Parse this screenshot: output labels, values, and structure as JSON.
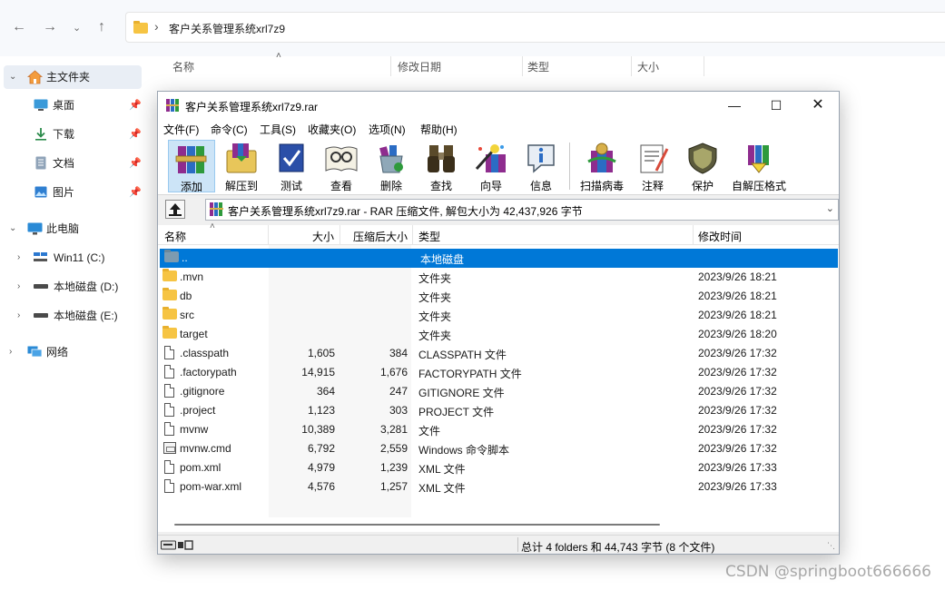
{
  "explorer": {
    "address_path": "客户关系管理系统xrl7z9",
    "columns": [
      "名称",
      "修改日期",
      "类型",
      "大小"
    ],
    "sidebar": {
      "home": "主文件夹",
      "quick": [
        "桌面",
        "下载",
        "文档",
        "图片"
      ],
      "this_pc": "此电脑",
      "drives": [
        "Win11 (C:)",
        "本地磁盘 (D:)",
        "本地磁盘 (E:)"
      ],
      "network": "网络"
    }
  },
  "rar": {
    "title": "客户关系管理系统xrl7z9.rar",
    "menu": [
      "文件(F)",
      "命令(C)",
      "工具(S)",
      "收藏夹(O)",
      "选项(N)",
      "帮助(H)"
    ],
    "toolbar": [
      {
        "label": "添加",
        "icon": "books-icon"
      },
      {
        "label": "解压到",
        "icon": "extract-folder-icon"
      },
      {
        "label": "测试",
        "icon": "test-icon"
      },
      {
        "label": "查看",
        "icon": "view-book-icon"
      },
      {
        "label": "删除",
        "icon": "delete-bin-icon"
      },
      {
        "label": "查找",
        "icon": "binoculars-icon"
      },
      {
        "label": "向导",
        "icon": "wizard-icon"
      },
      {
        "label": "信息",
        "icon": "info-icon"
      },
      {
        "label": "扫描病毒",
        "icon": "virus-scan-icon"
      },
      {
        "label": "注释",
        "icon": "comment-icon"
      },
      {
        "label": "保护",
        "icon": "shield-icon"
      },
      {
        "label": "自解压格式",
        "icon": "sfx-icon"
      }
    ],
    "path_text": "客户关系管理系统xrl7z9.rar - RAR 压缩文件, 解包大小为 42,437,926 字节",
    "columns": {
      "name": "名称",
      "size": "大小",
      "packed": "压缩后大小",
      "type": "类型",
      "modified": "修改时间"
    },
    "files": [
      {
        "name": "..",
        "size": "",
        "packed": "",
        "type": "本地磁盘",
        "modified": "",
        "kind": "up",
        "selected": true
      },
      {
        "name": ".mvn",
        "size": "",
        "packed": "",
        "type": "文件夹",
        "modified": "2023/9/26 18:21",
        "kind": "folder"
      },
      {
        "name": "db",
        "size": "",
        "packed": "",
        "type": "文件夹",
        "modified": "2023/9/26 18:21",
        "kind": "folder"
      },
      {
        "name": "src",
        "size": "",
        "packed": "",
        "type": "文件夹",
        "modified": "2023/9/26 18:21",
        "kind": "folder"
      },
      {
        "name": "target",
        "size": "",
        "packed": "",
        "type": "文件夹",
        "modified": "2023/9/26 18:20",
        "kind": "folder"
      },
      {
        "name": ".classpath",
        "size": "1,605",
        "packed": "384",
        "type": "CLASSPATH 文件",
        "modified": "2023/9/26 17:32",
        "kind": "file"
      },
      {
        "name": ".factorypath",
        "size": "14,915",
        "packed": "1,676",
        "type": "FACTORYPATH 文件",
        "modified": "2023/9/26 17:32",
        "kind": "file"
      },
      {
        "name": ".gitignore",
        "size": "364",
        "packed": "247",
        "type": "GITIGNORE 文件",
        "modified": "2023/9/26 17:32",
        "kind": "file"
      },
      {
        "name": ".project",
        "size": "1,123",
        "packed": "303",
        "type": "PROJECT 文件",
        "modified": "2023/9/26 17:32",
        "kind": "file"
      },
      {
        "name": "mvnw",
        "size": "10,389",
        "packed": "3,281",
        "type": "文件",
        "modified": "2023/9/26 17:32",
        "kind": "file"
      },
      {
        "name": "mvnw.cmd",
        "size": "6,792",
        "packed": "2,559",
        "type": "Windows 命令脚本",
        "modified": "2023/9/26 17:32",
        "kind": "cmd"
      },
      {
        "name": "pom.xml",
        "size": "4,979",
        "packed": "1,239",
        "type": "XML 文件",
        "modified": "2023/9/26 17:33",
        "kind": "file"
      },
      {
        "name": "pom-war.xml",
        "size": "4,576",
        "packed": "1,257",
        "type": "XML 文件",
        "modified": "2023/9/26 17:33",
        "kind": "file"
      }
    ],
    "status": "总计 4 folders 和 44,743 字节 (8 个文件)"
  },
  "watermark": "CSDN @springboot666666",
  "colors": {
    "selection": "#0078d7",
    "toolbar_active": "#cce4f7",
    "folder": "#f6c443"
  }
}
